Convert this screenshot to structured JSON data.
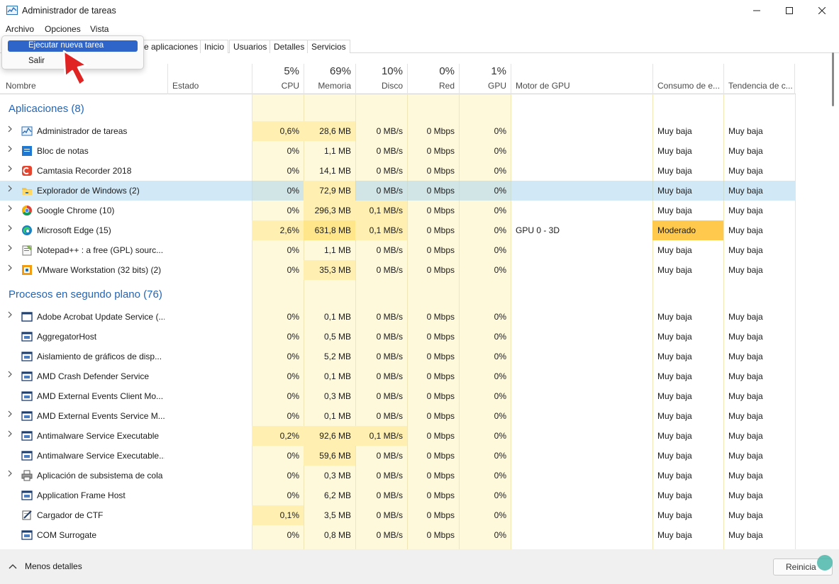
{
  "window": {
    "title": "Administrador de tareas"
  },
  "menu": [
    "Archivo",
    "Opciones",
    "Vista"
  ],
  "dropdown": {
    "items": [
      "Ejecutar nueva tarea",
      "Salir"
    ],
    "selected_index": 0
  },
  "tabs": [
    "e aplicaciones",
    "Inicio",
    "Usuarios",
    "Detalles",
    "Servicios"
  ],
  "columns": {
    "name": "Nombre",
    "status": "Estado",
    "cpu": {
      "pct": "5%",
      "label": "CPU"
    },
    "mem": {
      "pct": "69%",
      "label": "Memoria"
    },
    "disk": {
      "pct": "10%",
      "label": "Disco"
    },
    "net": {
      "pct": "0%",
      "label": "Red"
    },
    "gpu": {
      "pct": "1%",
      "label": "GPU"
    },
    "gpu_engine": "Motor de GPU",
    "power": "Consumo de e...",
    "power_trend": "Tendencia de c..."
  },
  "groups": [
    {
      "title": "Aplicaciones (8)",
      "rows": [
        {
          "name": "Administrador de tareas",
          "expand": true,
          "icon": "task-manager-icon",
          "cpu": "0,6%",
          "mem": "28,6 MB",
          "disk": "0 MB/s",
          "net": "0 Mbps",
          "gpu": "0%",
          "engine": "",
          "power": "Muy baja",
          "trend": "Muy baja"
        },
        {
          "name": "Bloc de notas",
          "expand": true,
          "icon": "notepad-icon",
          "cpu": "0%",
          "mem": "1,1 MB",
          "disk": "0 MB/s",
          "net": "0 Mbps",
          "gpu": "0%",
          "engine": "",
          "power": "Muy baja",
          "trend": "Muy baja"
        },
        {
          "name": "Camtasia Recorder 2018",
          "expand": true,
          "icon": "camtasia-icon",
          "cpu": "0%",
          "mem": "14,1 MB",
          "disk": "0 MB/s",
          "net": "0 Mbps",
          "gpu": "0%",
          "engine": "",
          "power": "Muy baja",
          "trend": "Muy baja"
        },
        {
          "name": "Explorador de Windows (2)",
          "expand": true,
          "icon": "folder-icon",
          "selected": true,
          "cpu": "0%",
          "mem": "72,9 MB",
          "disk": "0 MB/s",
          "net": "0 Mbps",
          "gpu": "0%",
          "engine": "",
          "power": "Muy baja",
          "trend": "Muy baja"
        },
        {
          "name": "Google Chrome (10)",
          "expand": true,
          "icon": "chrome-icon",
          "cpu": "0%",
          "mem": "296,3 MB",
          "disk": "0,1 MB/s",
          "net": "0 Mbps",
          "gpu": "0%",
          "engine": "",
          "power": "Muy baja",
          "trend": "Muy baja"
        },
        {
          "name": "Microsoft Edge (15)",
          "expand": true,
          "icon": "edge-icon",
          "cpu": "2,6%",
          "mem": "631,8 MB",
          "disk": "0,1 MB/s",
          "net": "0 Mbps",
          "gpu": "0%",
          "engine": "GPU 0 - 3D",
          "power": "Moderado",
          "trend": "Muy baja"
        },
        {
          "name": "Notepad++ : a free (GPL) sourc...",
          "expand": true,
          "icon": "notepadpp-icon",
          "cpu": "0%",
          "mem": "1,1 MB",
          "disk": "0 MB/s",
          "net": "0 Mbps",
          "gpu": "0%",
          "engine": "",
          "power": "Muy baja",
          "trend": "Muy baja"
        },
        {
          "name": "VMware Workstation (32 bits) (2)",
          "expand": true,
          "icon": "vmware-icon",
          "cpu": "0%",
          "mem": "35,3 MB",
          "disk": "0 MB/s",
          "net": "0 Mbps",
          "gpu": "0%",
          "engine": "",
          "power": "Muy baja",
          "trend": "Muy baja"
        }
      ]
    },
    {
      "title": "Procesos en segundo plano (76)",
      "rows": [
        {
          "name": "Adobe Acrobat Update Service (...",
          "expand": true,
          "icon": "window-icon",
          "cpu": "0%",
          "mem": "0,1 MB",
          "disk": "0 MB/s",
          "net": "0 Mbps",
          "gpu": "0%",
          "engine": "",
          "power": "Muy baja",
          "trend": "Muy baja"
        },
        {
          "name": "AggregatorHost",
          "expand": false,
          "icon": "service-icon",
          "cpu": "0%",
          "mem": "0,5 MB",
          "disk": "0 MB/s",
          "net": "0 Mbps",
          "gpu": "0%",
          "engine": "",
          "power": "Muy baja",
          "trend": "Muy baja"
        },
        {
          "name": "Aislamiento de gráficos de disp...",
          "expand": false,
          "icon": "service-icon",
          "cpu": "0%",
          "mem": "5,2 MB",
          "disk": "0 MB/s",
          "net": "0 Mbps",
          "gpu": "0%",
          "engine": "",
          "power": "Muy baja",
          "trend": "Muy baja"
        },
        {
          "name": "AMD Crash Defender Service",
          "expand": true,
          "icon": "service-icon",
          "cpu": "0%",
          "mem": "0,1 MB",
          "disk": "0 MB/s",
          "net": "0 Mbps",
          "gpu": "0%",
          "engine": "",
          "power": "Muy baja",
          "trend": "Muy baja"
        },
        {
          "name": "AMD External Events Client Mo...",
          "expand": false,
          "icon": "service-icon",
          "cpu": "0%",
          "mem": "0,3 MB",
          "disk": "0 MB/s",
          "net": "0 Mbps",
          "gpu": "0%",
          "engine": "",
          "power": "Muy baja",
          "trend": "Muy baja"
        },
        {
          "name": "AMD External Events Service M...",
          "expand": true,
          "icon": "service-icon",
          "cpu": "0%",
          "mem": "0,1 MB",
          "disk": "0 MB/s",
          "net": "0 Mbps",
          "gpu": "0%",
          "engine": "",
          "power": "Muy baja",
          "trend": "Muy baja"
        },
        {
          "name": "Antimalware Service Executable",
          "expand": true,
          "icon": "service-icon",
          "cpu": "0,2%",
          "mem": "92,6 MB",
          "disk": "0,1 MB/s",
          "net": "0 Mbps",
          "gpu": "0%",
          "engine": "",
          "power": "Muy baja",
          "trend": "Muy baja"
        },
        {
          "name": "Antimalware Service Executable...",
          "expand": false,
          "icon": "service-icon",
          "cpu": "0%",
          "mem": "59,6 MB",
          "disk": "0 MB/s",
          "net": "0 Mbps",
          "gpu": "0%",
          "engine": "",
          "power": "Muy baja",
          "trend": "Muy baja"
        },
        {
          "name": "Aplicación de subsistema de cola",
          "expand": true,
          "icon": "printer-icon",
          "cpu": "0%",
          "mem": "0,3 MB",
          "disk": "0 MB/s",
          "net": "0 Mbps",
          "gpu": "0%",
          "engine": "",
          "power": "Muy baja",
          "trend": "Muy baja"
        },
        {
          "name": "Application Frame Host",
          "expand": false,
          "icon": "service-icon",
          "cpu": "0%",
          "mem": "6,2 MB",
          "disk": "0 MB/s",
          "net": "0 Mbps",
          "gpu": "0%",
          "engine": "",
          "power": "Muy baja",
          "trend": "Muy baja"
        },
        {
          "name": "Cargador de CTF",
          "expand": false,
          "icon": "ctf-icon",
          "cpu": "0,1%",
          "mem": "3,5 MB",
          "disk": "0 MB/s",
          "net": "0 Mbps",
          "gpu": "0%",
          "engine": "",
          "power": "Muy baja",
          "trend": "Muy baja"
        },
        {
          "name": "COM Surrogate",
          "expand": false,
          "icon": "service-icon",
          "cpu": "0%",
          "mem": "0,8 MB",
          "disk": "0 MB/s",
          "net": "0 Mbps",
          "gpu": "0%",
          "engine": "",
          "power": "Muy baja",
          "trend": "Muy baja"
        }
      ]
    }
  ],
  "footer": {
    "less_details": "Menos detalles",
    "restart_label": "Reinicia"
  },
  "colors": {
    "heat_light": "#fff9db",
    "heat_mid": "#ffefb0",
    "heat_strong": "#ffe68a",
    "moderate": "#ffc94d",
    "selected_row": "#cce8f7",
    "accent": "#2365b8",
    "menu_selection": "#2f64c8"
  }
}
